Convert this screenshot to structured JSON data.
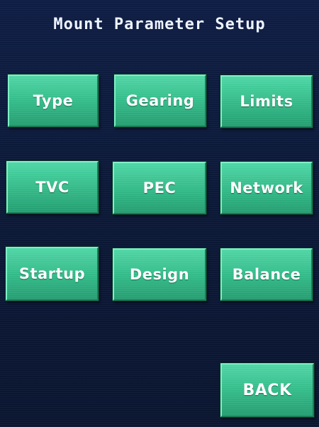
{
  "screen": {
    "title": "Mount Parameter Setup"
  },
  "buttons": {
    "type": "Type",
    "gearing": "Gearing",
    "limits": "Limits",
    "tvc": "TVC",
    "pec": "PEC",
    "network": "Network",
    "startup": "Startup",
    "design": "Design",
    "balance": "Balance",
    "back": "BACK"
  },
  "colors": {
    "background": "#0c1a3c",
    "button_fill": "#33b988",
    "button_highlight": "#7ef0c6",
    "text": "#ffffff"
  }
}
